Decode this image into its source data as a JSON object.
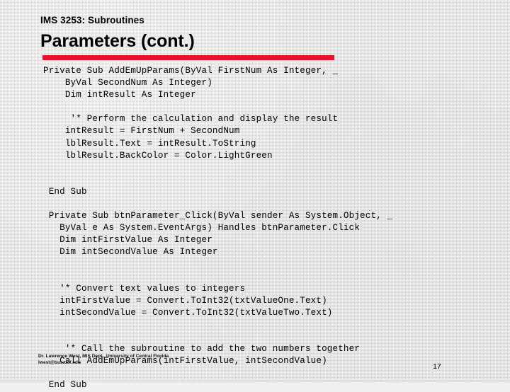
{
  "slide": {
    "kicker": "IMS 3253: Subroutines",
    "title": "Parameters (cont.)",
    "accent_color": "#e8112d",
    "background_color": "#f2f1ef",
    "page_number": "17"
  },
  "code": {
    "language": "vb-net",
    "lines": [
      "Private Sub AddEmUpParams(ByVal FirstNum As Integer, _",
      "    ByVal SecondNum As Integer)",
      "    Dim intResult As Integer",
      "",
      "     '* Perform the calculation and display the result",
      "    intResult = FirstNum + SecondNum",
      "    lblResult.Text = intResult.ToString",
      "    lblResult.BackColor = Color.LightGreen",
      "",
      "",
      " End Sub",
      "",
      " Private Sub btnParameter_Click(ByVal sender As System.Object, _",
      "   ByVal e As System.EventArgs) Handles btnParameter.Click",
      "   Dim intFirstValue As Integer",
      "   Dim intSecondValue As Integer",
      "",
      "",
      "   '* Convert text values to integers",
      "   intFirstValue = Convert.ToInt32(txtValueOne.Text)",
      "   intSecondValue = Convert.ToInt32(txtValueTwo.Text)",
      "",
      "",
      "    '* Call the subroutine to add the two numbers together",
      "   Call AddEmUpParams(intFirstValue, intSecondValue)",
      "",
      " End Sub"
    ]
  },
  "footer": {
    "credit_line_1": "Dr. Lawrence West, MIS Dept., University of Central Florida",
    "credit_line_2": "lwest@bus.ucf.edu"
  }
}
